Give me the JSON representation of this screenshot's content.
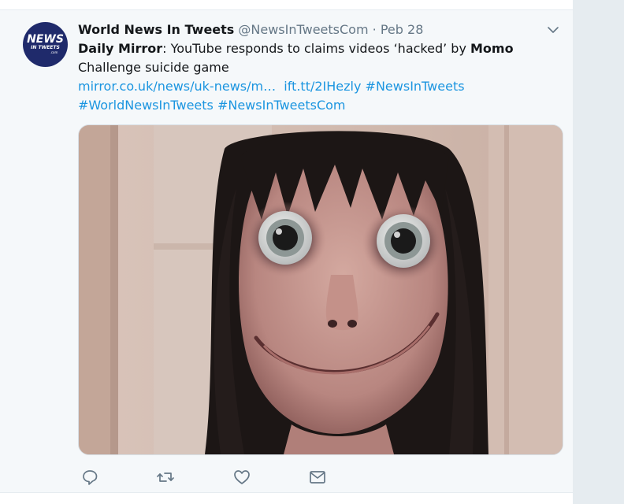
{
  "tweet": {
    "author_name": "World News In Tweets",
    "author_handle": "@NewsInTweetsCom",
    "separator": "·",
    "date": "Peb 28",
    "avatar_text": {
      "line1": "NEWS",
      "line2": "IN TWEETS",
      "line3": ".com"
    },
    "text_segments": [
      {
        "text": "Daily Mirror",
        "bold": true
      },
      {
        "text": ": YouTube responds to claims videos ‘hacked’ by ",
        "bold": false
      },
      {
        "text": "Momo",
        "bold": true
      },
      {
        "text": " Challenge suicide game",
        "bold": false
      }
    ],
    "links": {
      "url1": "mirror.co.uk/news/uk-news/m…",
      "url2": "ift.tt/2IHezly",
      "tag1": "#NewsInTweets",
      "tag2": "#WorldNewsInTweets",
      "tag3": "#NewsInTweetsCom"
    },
    "media_alt_icon": "photo-of-momo-figure"
  },
  "actions": {
    "reply_icon": "reply-icon",
    "retweet_icon": "retweet-icon",
    "like_icon": "heart-icon",
    "dm_icon": "envelope-icon"
  },
  "colors": {
    "link": "#1b95e0",
    "muted": "#657786",
    "text": "#14171a",
    "tweet_bg": "#f5f8fa",
    "page_bg": "#e6ecf0"
  }
}
